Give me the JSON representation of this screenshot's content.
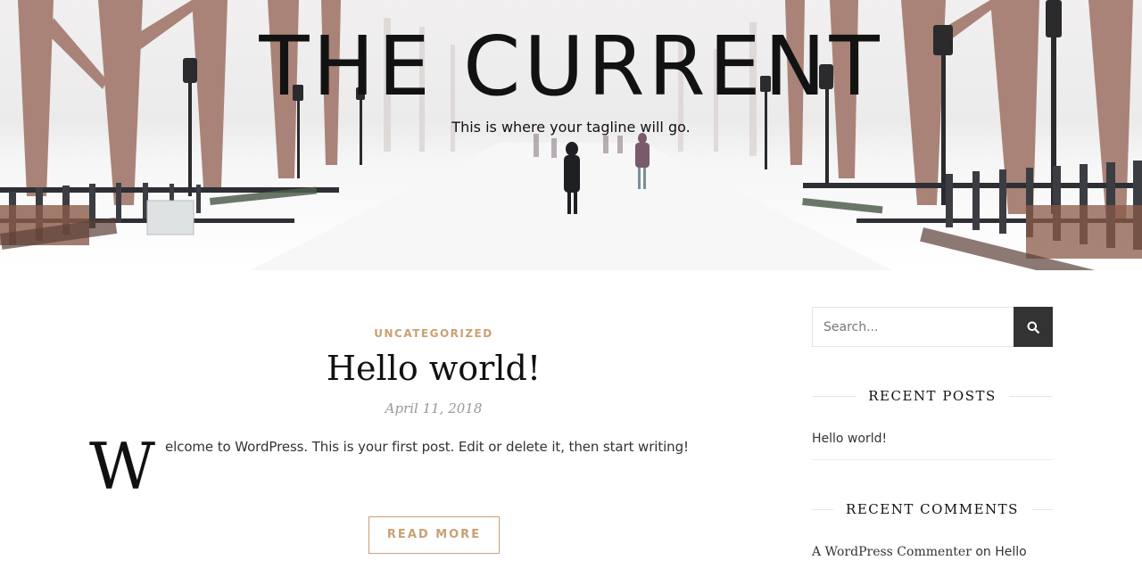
{
  "header": {
    "site_title": "THE CURRENT",
    "tagline": "This is where your tagline will go."
  },
  "post": {
    "category": "UNCATEGORIZED",
    "title": "Hello world!",
    "date": "April 11, 2018",
    "dropcap": "W",
    "excerpt": "elcome to WordPress. This is your first post. Edit or delete it, then start writing!",
    "read_more": "READ MORE"
  },
  "sidebar": {
    "search": {
      "placeholder": "Search...",
      "value": ""
    },
    "recent_posts": {
      "heading": "RECENT POSTS",
      "items": [
        "Hello world!"
      ]
    },
    "recent_comments": {
      "heading": "RECENT COMMENTS",
      "author": "A WordPress Commenter",
      "connector": "on",
      "post": "Hello"
    }
  },
  "icons": {
    "search": "search-icon"
  },
  "colors": {
    "accent": "#c9a173",
    "button_dark": "#333333",
    "text": "#333333"
  }
}
